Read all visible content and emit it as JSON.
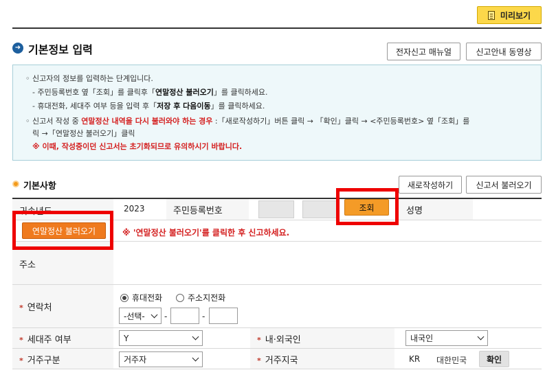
{
  "toolbar": {
    "preview_label": "미리보기"
  },
  "section": {
    "title": "기본정보 입력",
    "manual_button": "전자신고 매뉴얼",
    "video_button": "신고안내 동영상"
  },
  "info": {
    "line1": "신고자의 정보를 입력하는 단계입니다.",
    "line2_a": "- 주민등록번호 옆「조회」를 클릭후「",
    "line2_b": "연말정산 불러오기",
    "line2_c": "」를 클릭하세요.",
    "line3_a": "- 휴대전화, 세대주 여부 등을 입력 후「",
    "line3_b": "저장 후 다음이동",
    "line3_c": "」를 클릭하세요.",
    "line4_a": "신고서 작성 중 ",
    "line4_b": "연말정산 내역을 다시 불러와야 하는 경우",
    "line4_c": " :「새로작성하기」버튼 클릭 → 「확인」클릭 → <주민등록번호> 옆「조회」를",
    "line5": "릭 →「연말정산 불러오기」클릭",
    "line6": "※ 이때, 작성중이던 신고서는 초기화되므로 유의하시기 바랍니다."
  },
  "basic": {
    "title": "기본사항",
    "new_button": "새로작성하기",
    "load_button": "신고서 불러오기",
    "year_label": "귀속년도",
    "year_value": "2023",
    "rrn_label": "주민등록번호",
    "lookup_button": "조회",
    "name_label": "성명",
    "yearend_button": "연말정산 불러오기",
    "yearend_notice": "※ '연말정산 불러오기'를 클릭한 후 신고하세요.",
    "address_label": "주소",
    "contact_label": "연락처",
    "radio_mobile": "휴대전화",
    "radio_home": "주소지전화",
    "phone_select": "-선택-",
    "dash": "-",
    "householder_label": "세대주 여부",
    "householder_value": "Y",
    "nationality_label": "내·외국인",
    "nationality_value": "내국인",
    "residence_label": "거주구분",
    "residence_value": "거주자",
    "country_label": "거주지국",
    "country_code": "KR",
    "country_name": "대한민국",
    "confirm_button": "확인",
    "required_mark": "*"
  }
}
